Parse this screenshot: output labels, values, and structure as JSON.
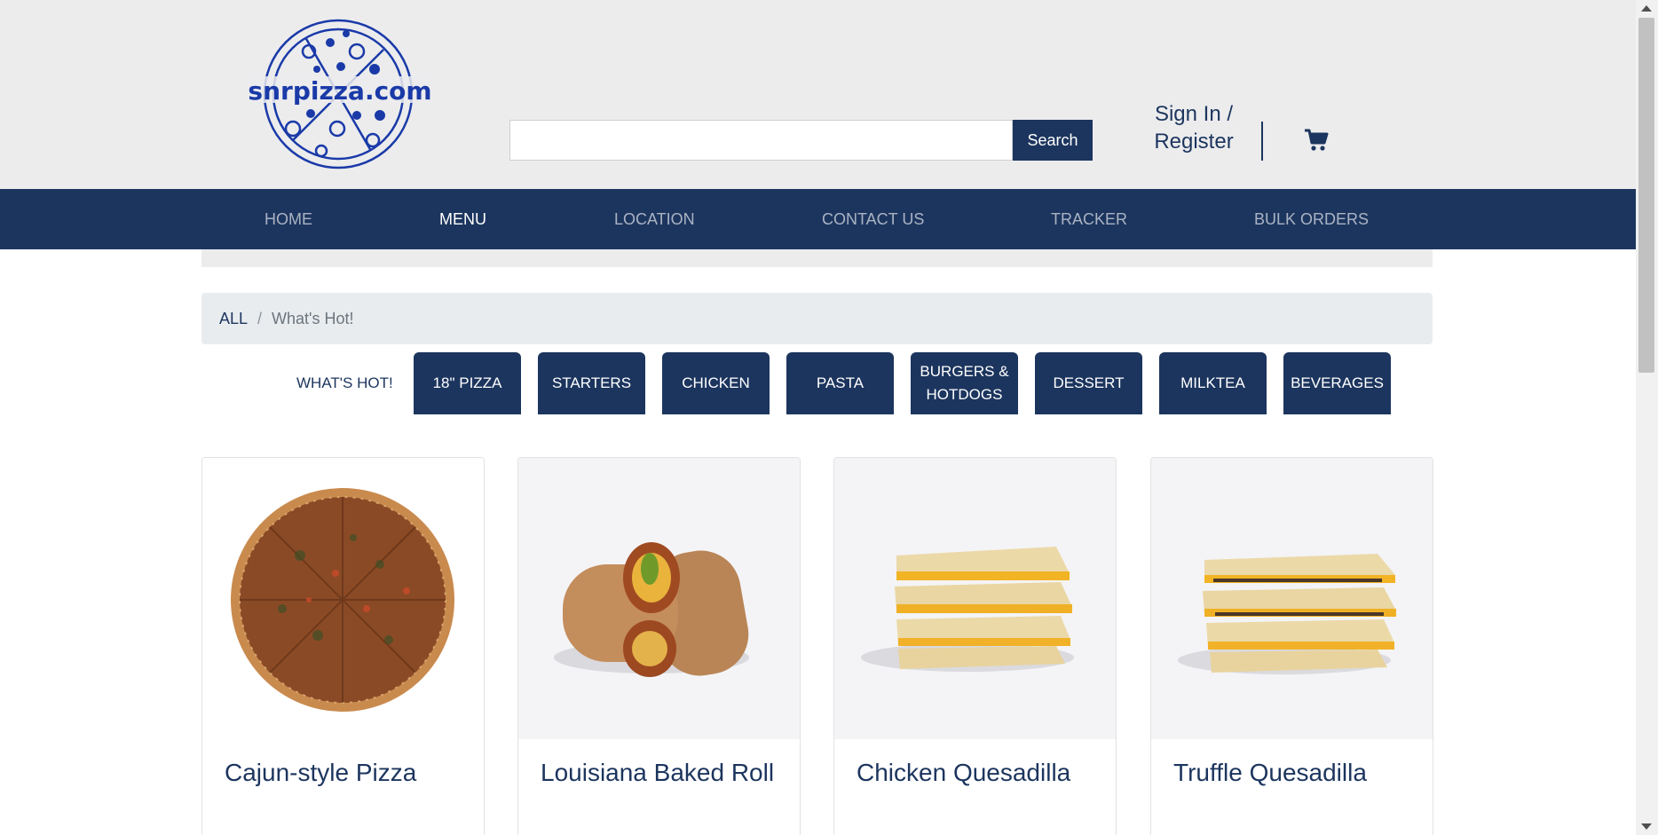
{
  "brand": {
    "logo_text": "snrpizza.com",
    "primary_color": "#1c355e",
    "logo_color": "#1a3aa8"
  },
  "header": {
    "search": {
      "placeholder": "",
      "value": "",
      "button_label": "Search"
    },
    "signin": {
      "line1": "Sign In /",
      "line2": "Register"
    },
    "cart_icon": "shopping-cart-icon"
  },
  "nav": {
    "items": [
      {
        "label": "HOME",
        "active": false
      },
      {
        "label": "MENU",
        "active": true
      },
      {
        "label": "LOCATION",
        "active": false
      },
      {
        "label": "CONTACT US",
        "active": false
      },
      {
        "label": "TRACKER",
        "active": false
      },
      {
        "label": "BULK ORDERS",
        "active": false
      }
    ]
  },
  "breadcrumb": {
    "root": "ALL",
    "separator": "/",
    "current": "What's Hot!"
  },
  "categories": {
    "active_label": "WHAT'S HOT!",
    "tabs": [
      {
        "label": "18\" PIZZA"
      },
      {
        "label": "STARTERS"
      },
      {
        "label": "CHICKEN"
      },
      {
        "label": "PASTA"
      },
      {
        "label": "BURGERS & HOTDOGS"
      },
      {
        "label": "DESSERT"
      },
      {
        "label": "MILKTEA"
      },
      {
        "label": "BEVERAGES"
      }
    ]
  },
  "products": [
    {
      "name": "Cajun-style Pizza",
      "image": "pizza-image"
    },
    {
      "name": "Louisiana Baked Roll",
      "image": "baked-roll-image"
    },
    {
      "name": "Chicken Quesadilla",
      "image": "chicken-quesadilla-image"
    },
    {
      "name": "Truffle Quesadilla",
      "image": "truffle-quesadilla-image"
    }
  ]
}
